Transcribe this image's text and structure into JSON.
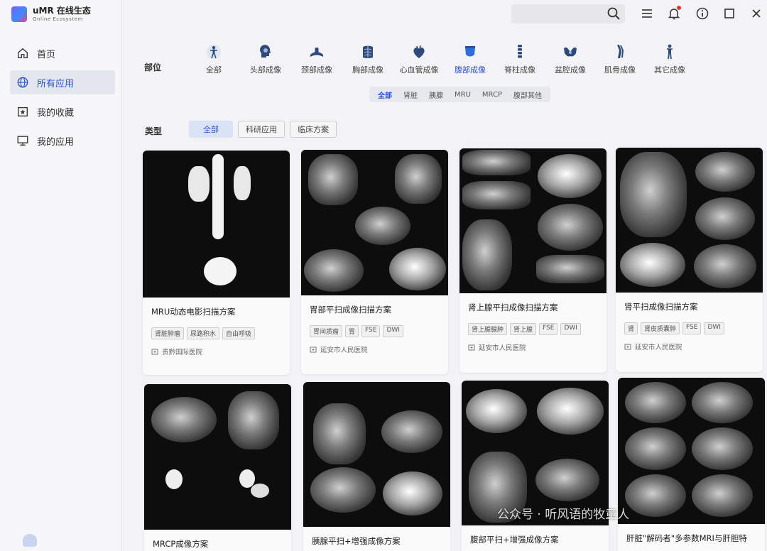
{
  "app": {
    "title": "uMR 在线生态",
    "subtitle": "Online Ecosystem"
  },
  "sidebar": {
    "items": [
      {
        "label": "首页",
        "icon": "home-icon",
        "active": false
      },
      {
        "label": "所有应用",
        "icon": "globe-icon",
        "active": true
      },
      {
        "label": "我的收藏",
        "icon": "star-folder-icon",
        "active": false
      },
      {
        "label": "我的应用",
        "icon": "monitor-icon",
        "active": false
      }
    ]
  },
  "topbar": {
    "search_placeholder": ""
  },
  "filters": {
    "body_part_label": "部位",
    "body_parts": [
      "全部",
      "头部成像",
      "颈部成像",
      "胸部成像",
      "心血管成像",
      "腹部成像",
      "脊柱成像",
      "盆腔成像",
      "肌骨成像",
      "其它成像"
    ],
    "active_body_part": "腹部成像",
    "sub_tabs": [
      "全部",
      "肾脏",
      "胰腺",
      "MRU",
      "MRCP",
      "腹部其他"
    ],
    "active_sub_tab": "全部",
    "type_label": "类型",
    "types": [
      "全部",
      "科研应用",
      "临床方案"
    ],
    "active_type": "全部"
  },
  "cards": [
    {
      "title": "MRU动态电影扫描方案",
      "tags": [
        "肾脏肿瘤",
        "尿路积水",
        "自由呼吸"
      ],
      "hospital": "贵黔国际医院"
    },
    {
      "title": "胃部平扫成像扫描方案",
      "tags": [
        "胃间质瘤",
        "胃",
        "FSE",
        "DWI"
      ],
      "hospital": "延安市人民医院"
    },
    {
      "title": "肾上腺平扫成像扫描方案",
      "tags": [
        "肾上腺腺肿",
        "肾上腺",
        "FSE",
        "DWI"
      ],
      "hospital": "延安市人民医院"
    },
    {
      "title": "肾平扫成像扫描方案",
      "tags": [
        "肾",
        "肾皮质囊肿",
        "FSE",
        "DWI"
      ],
      "hospital": "延安市人民医院"
    },
    {
      "title": "MRCP成像方案",
      "tags": [],
      "hospital": ""
    },
    {
      "title": "胰腺平扫+增强成像方案",
      "tags": [],
      "hospital": ""
    },
    {
      "title": "腹部平扫+增强成像方案",
      "tags": [],
      "hospital": ""
    },
    {
      "title": "肝脏\"解码者\"多参数MRI与肝胆特",
      "tags": [],
      "hospital": ""
    }
  ],
  "watermark": "公众号 · 听风语的牧童人",
  "colors": {
    "accent": "#2d55c8",
    "active_bg": "#e3e6ee",
    "notification": "#e53935"
  }
}
